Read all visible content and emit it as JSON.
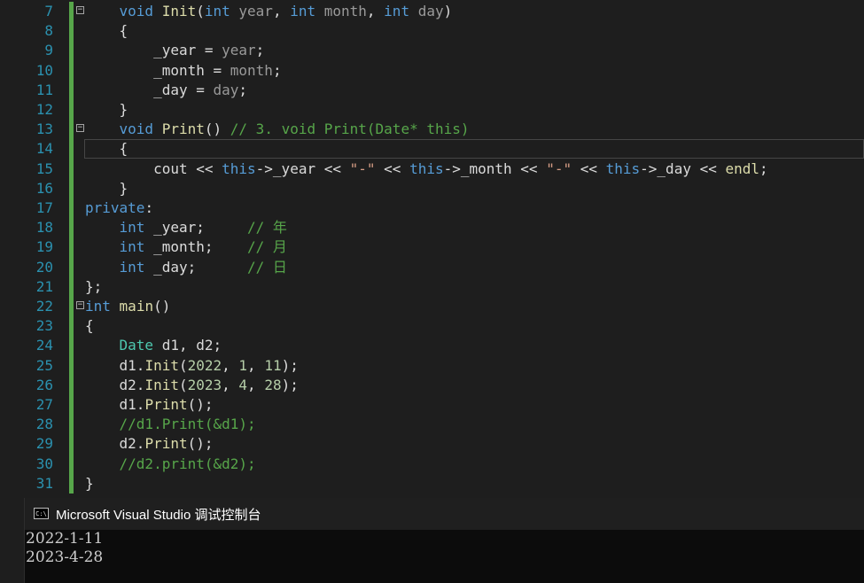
{
  "editor": {
    "lines": [
      {
        "n": "7",
        "tokens": [
          [
            "",
            "    "
          ],
          [
            "kw",
            "void "
          ],
          [
            "fn",
            "Init"
          ],
          [
            "",
            "("
          ],
          [
            "kw",
            "int "
          ],
          [
            "pa",
            "year"
          ],
          [
            "",
            ", "
          ],
          [
            "kw",
            "int "
          ],
          [
            "pa",
            "month"
          ],
          [
            "",
            ", "
          ],
          [
            "kw",
            "int "
          ],
          [
            "pa",
            "day"
          ],
          [
            "",
            ")"
          ]
        ],
        "fold": true
      },
      {
        "n": "8",
        "tokens": [
          [
            "",
            "    {"
          ]
        ]
      },
      {
        "n": "9",
        "tokens": [
          [
            "",
            "        "
          ],
          [
            "va",
            "_year"
          ],
          [
            "",
            " = "
          ],
          [
            "pa",
            "year"
          ],
          [
            "",
            ";"
          ]
        ]
      },
      {
        "n": "10",
        "tokens": [
          [
            "",
            "        "
          ],
          [
            "va",
            "_month"
          ],
          [
            "",
            " = "
          ],
          [
            "pa",
            "month"
          ],
          [
            "",
            ";"
          ]
        ]
      },
      {
        "n": "11",
        "tokens": [
          [
            "",
            "        "
          ],
          [
            "va",
            "_day"
          ],
          [
            "",
            " = "
          ],
          [
            "pa",
            "day"
          ],
          [
            "",
            ";"
          ]
        ]
      },
      {
        "n": "12",
        "tokens": [
          [
            "",
            "    }"
          ]
        ]
      },
      {
        "n": "13",
        "tokens": [
          [
            "",
            "    "
          ],
          [
            "kw",
            "void "
          ],
          [
            "fn",
            "Print"
          ],
          [
            "",
            "() "
          ],
          [
            "cm",
            "// 3. void Print(Date* this)"
          ]
        ],
        "fold": true
      },
      {
        "n": "14",
        "tokens": [
          [
            "",
            "    {"
          ]
        ]
      },
      {
        "n": "15",
        "tokens": [
          [
            "",
            "        "
          ],
          [
            "va",
            "cout"
          ],
          [
            "",
            " << "
          ],
          [
            "kw",
            "this"
          ],
          [
            "",
            "->"
          ],
          [
            "va",
            "_year"
          ],
          [
            "",
            " << "
          ],
          [
            "st",
            "\"-\""
          ],
          [
            "",
            " << "
          ],
          [
            "kw",
            "this"
          ],
          [
            "",
            "->"
          ],
          [
            "va",
            "_month"
          ],
          [
            "",
            " << "
          ],
          [
            "st",
            "\"-\""
          ],
          [
            "",
            " << "
          ],
          [
            "kw",
            "this"
          ],
          [
            "",
            "->"
          ],
          [
            "va",
            "_day"
          ],
          [
            "",
            " << "
          ],
          [
            "fn",
            "endl"
          ],
          [
            "",
            ";"
          ]
        ]
      },
      {
        "n": "16",
        "tokens": [
          [
            "",
            "    }"
          ]
        ]
      },
      {
        "n": "17",
        "tokens": [
          [
            "kw",
            "private"
          ],
          [
            "",
            ":"
          ]
        ]
      },
      {
        "n": "18",
        "tokens": [
          [
            "",
            "    "
          ],
          [
            "kw",
            "int"
          ],
          [
            "",
            " _year;     "
          ],
          [
            "cm",
            "// 年"
          ]
        ]
      },
      {
        "n": "19",
        "tokens": [
          [
            "",
            "    "
          ],
          [
            "kw",
            "int"
          ],
          [
            "",
            " _month;    "
          ],
          [
            "cm",
            "// 月"
          ]
        ]
      },
      {
        "n": "20",
        "tokens": [
          [
            "",
            "    "
          ],
          [
            "kw",
            "int"
          ],
          [
            "",
            " _day;      "
          ],
          [
            "cm",
            "// 日"
          ]
        ]
      },
      {
        "n": "21",
        "tokens": [
          [
            "",
            "};"
          ]
        ]
      },
      {
        "n": "22",
        "tokens": [
          [
            "kw",
            "int"
          ],
          [
            "",
            " "
          ],
          [
            "fn",
            "main"
          ],
          [
            "",
            "()"
          ]
        ],
        "fold": true
      },
      {
        "n": "23",
        "tokens": [
          [
            "",
            "{"
          ]
        ]
      },
      {
        "n": "24",
        "tokens": [
          [
            "",
            "    "
          ],
          [
            "ty",
            "Date"
          ],
          [
            "",
            " "
          ],
          [
            "va",
            "d1"
          ],
          [
            "",
            ", "
          ],
          [
            "va",
            "d2"
          ],
          [
            "",
            ";"
          ]
        ]
      },
      {
        "n": "25",
        "tokens": [
          [
            "",
            "    "
          ],
          [
            "va",
            "d1"
          ],
          [
            "",
            "."
          ],
          [
            "fn",
            "Init"
          ],
          [
            "",
            "("
          ],
          [
            "nm",
            "2022"
          ],
          [
            "",
            ", "
          ],
          [
            "nm",
            "1"
          ],
          [
            "",
            ", "
          ],
          [
            "nm",
            "11"
          ],
          [
            "",
            ");"
          ]
        ]
      },
      {
        "n": "26",
        "tokens": [
          [
            "",
            "    "
          ],
          [
            "va",
            "d2"
          ],
          [
            "",
            "."
          ],
          [
            "fn",
            "Init"
          ],
          [
            "",
            "("
          ],
          [
            "nm",
            "2023"
          ],
          [
            "",
            ", "
          ],
          [
            "nm",
            "4"
          ],
          [
            "",
            ", "
          ],
          [
            "nm",
            "28"
          ],
          [
            "",
            ");"
          ]
        ]
      },
      {
        "n": "27",
        "tokens": [
          [
            "",
            "    "
          ],
          [
            "va",
            "d1"
          ],
          [
            "",
            "."
          ],
          [
            "fn",
            "Print"
          ],
          [
            "",
            "();"
          ]
        ]
      },
      {
        "n": "28",
        "tokens": [
          [
            "",
            "    "
          ],
          [
            "cm",
            "//d1.Print(&d1);"
          ]
        ]
      },
      {
        "n": "29",
        "tokens": [
          [
            "",
            "    "
          ],
          [
            "va",
            "d2"
          ],
          [
            "",
            "."
          ],
          [
            "fn",
            "Print"
          ],
          [
            "",
            "();"
          ]
        ]
      },
      {
        "n": "30",
        "tokens": [
          [
            "",
            "    "
          ],
          [
            "cm",
            "//d2.print(&d2);"
          ]
        ]
      },
      {
        "n": "31",
        "tokens": [
          [
            "",
            "}"
          ]
        ]
      }
    ]
  },
  "console": {
    "icon_text": "C:\\",
    "title": "Microsoft Visual Studio 调试控制台",
    "output_lines": [
      "2022-1-11",
      "2023-4-28"
    ]
  },
  "colors": {
    "line_number": "#2b91af",
    "keyword": "#569cd6",
    "function": "#dcdcaa",
    "type": "#4ec9b0",
    "comment": "#57a64a",
    "string": "#d69d85",
    "number": "#b5cea8"
  }
}
